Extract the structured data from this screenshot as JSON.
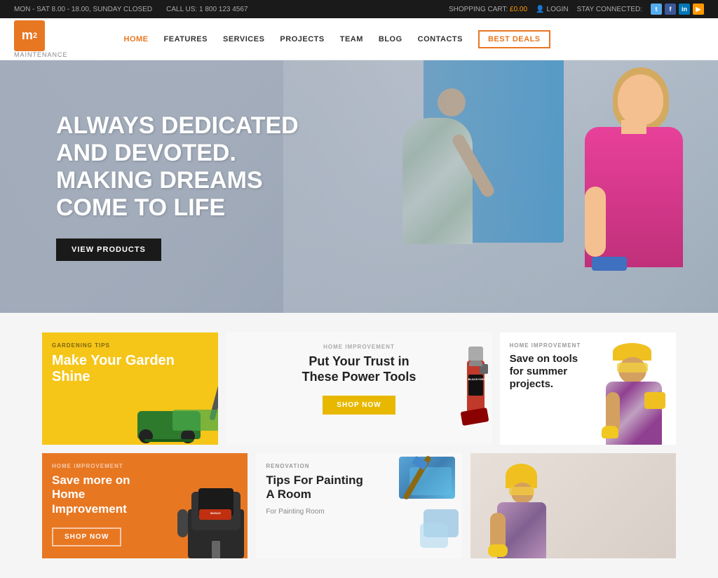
{
  "topbar": {
    "schedule": "MON - SAT 8.00 - 18.00, SUNDAY CLOSED",
    "phone_label": "CALL US: 1 800 123 4567",
    "cart_label": "SHOPPING CART:",
    "cart_price": "£0.00",
    "login_label": "LOGIN",
    "stay_connected": "STAY CONNECTED:"
  },
  "logo": {
    "letter": "m",
    "sup": "2",
    "tagline": "MAINTENANCE"
  },
  "nav": {
    "home": "HOME",
    "features": "FEATURES",
    "services": "SERVICES",
    "projects": "PROJECTS",
    "team": "TEAM",
    "blog": "BLOG",
    "contacts": "CONTACTS",
    "best_deals": "BEST DEALS"
  },
  "hero": {
    "line1": "ALWAYS DEDICATED",
    "line2": "AND DEVOTED.",
    "line3": "MAKING DREAMS",
    "line4": "COME TO LIFE",
    "cta": "VIEW PRODUCTS"
  },
  "cards": {
    "card1": {
      "category": "GARDENING TIPS",
      "title": "Make Your Garden Shine",
      "bg": "yellow"
    },
    "card2": {
      "category": "HOME IMPROVEMENT",
      "title": "Put Your Trust in These Power Tools",
      "cta": "SHOP NOW",
      "bg": "white"
    },
    "card3": {
      "category": "HOME IMPROVEMENT",
      "title": "Save on tools for summer projects.",
      "bg": "white"
    },
    "card4": {
      "category": "HOME IMPROVEMENT",
      "title": "Save more on Home Improvement",
      "cta": "SHOP NOW",
      "bg": "orange"
    },
    "card5": {
      "category": "RENOVATION",
      "title": "Tips For Painting A Room",
      "subtitle": "For Painting Room",
      "bg": "white"
    },
    "card6": {
      "bg": "white"
    }
  }
}
